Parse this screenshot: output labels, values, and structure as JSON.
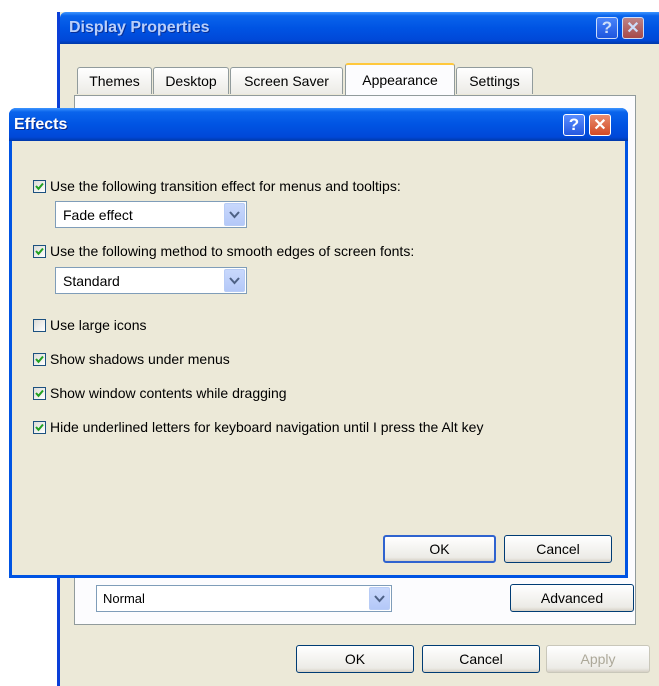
{
  "display_properties": {
    "title": "Display Properties",
    "tabs": [
      {
        "label": "Themes",
        "active": false
      },
      {
        "label": "Desktop",
        "active": false
      },
      {
        "label": "Screen Saver",
        "active": false
      },
      {
        "label": "Appearance",
        "active": true
      },
      {
        "label": "Settings",
        "active": false
      }
    ],
    "font_size_value": "Normal",
    "advanced_label": "Advanced",
    "ok_label": "OK",
    "cancel_label": "Cancel",
    "apply_label": "Apply",
    "help_glyph": "?",
    "close_glyph": "✕"
  },
  "effects": {
    "title": "Effects",
    "help_glyph": "?",
    "close_glyph": "✕",
    "options": [
      {
        "label": "Use the following transition effect for menus and tooltips:",
        "checked": true
      },
      {
        "label": "Use the following method to smooth edges of screen fonts:",
        "checked": true
      },
      {
        "label": "Use large icons",
        "checked": false
      },
      {
        "label": "Show shadows under menus",
        "checked": true
      },
      {
        "label": "Show window contents while dragging",
        "checked": true
      },
      {
        "label": "Hide underlined letters for keyboard navigation until I press the Alt key",
        "checked": true
      }
    ],
    "transition_value": "Fade effect",
    "smoothing_value": "Standard",
    "ok_label": "OK",
    "cancel_label": "Cancel"
  },
  "colors": {
    "titlebar_blue": "#0054e3",
    "dialog_face": "#ece9d8",
    "check_green": "#21a121",
    "close_red": "#d24a25"
  }
}
